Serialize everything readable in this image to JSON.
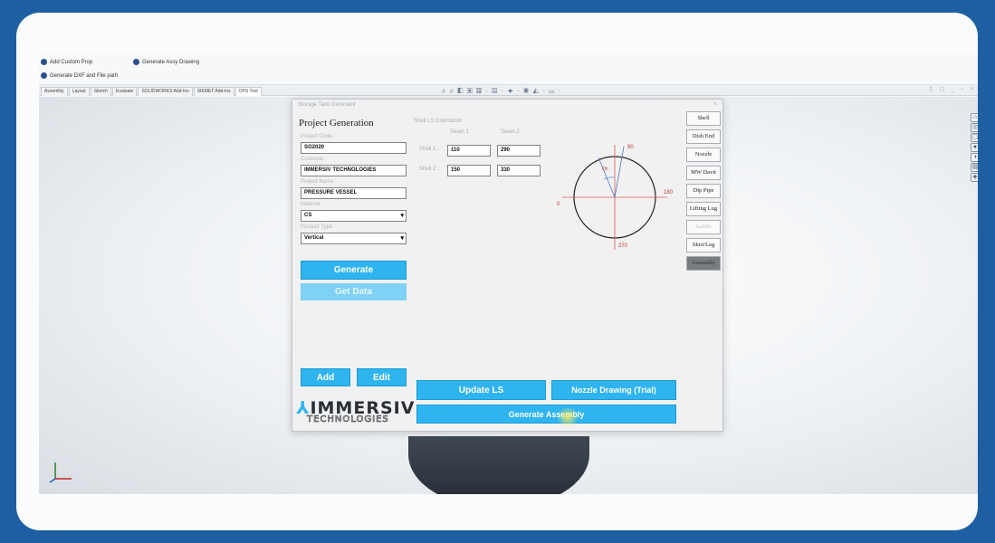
{
  "commands": {
    "add_custom_prop": "Add Custom Prop",
    "generate_assy_drawing": "Generate Assy Drawing",
    "generate_dxf": "Generate DXF and File path"
  },
  "tabs": [
    "Assembly",
    "Layout",
    "Sketch",
    "Evaluate",
    "SOLIDWORKS Add-Ins",
    "SIEMET Add-Ins",
    "OPS Tool"
  ],
  "view_tools": "⌕ ⌕ ◧ ▣ ▦ · ▤ · ✦ · ◉ ◭ · ▭ ·",
  "window_controls": "▯ ▢ _ ▫ ×",
  "dialog": {
    "title": "Storage Tank Generator",
    "close": "×",
    "heading": "Project Generation",
    "project_code_label": "Project Code :",
    "project_code_value": "SO2020",
    "customer_label": "Customer :",
    "customer_value": "IMMERSIV TECHNOLOGIES",
    "project_name_label": "Project Name :",
    "project_name_value": "PRESSURE VESSEL",
    "material_label": "Material :",
    "material_value": "CS",
    "product_type_label": "Product Type :",
    "product_type_value": "Vertical",
    "generate_label": "Generate",
    "get_data_label": "Get Data",
    "add_label": "Add",
    "edit_label": "Edit",
    "orientation_title": "Shell LS Orientation",
    "seam1_header": "Seam 1",
    "seam2_header": "Seam 2",
    "shell1_label": "Shell 1 :",
    "shell2_label": "Shell 2 :",
    "shell1_seam1": "110",
    "shell1_seam2": "290",
    "shell2_seam1": "150",
    "shell2_seam2": "330",
    "angle_90": "90",
    "angle_0": "0",
    "angle_180": "180",
    "angle_270": "270",
    "angle_small": "On",
    "update_ls_label": "Update LS",
    "nozzle_drawing_label": "Nozzle Drawing (Trial)",
    "generate_assembly_label": "Generate Assembly",
    "side_buttons": {
      "shell": "Shell",
      "dish_end": "Dish End",
      "nozzle": "Nozzle",
      "mw_davit": "MW Davit",
      "dip_pipe": "Dip Pipe",
      "lifting_lug": "Lifting Lug",
      "saddle": "Saddle",
      "skirt_leg": "Skirt/Leg",
      "assembly": "Assembly"
    }
  },
  "logo": {
    "brand": "IMMERSIV",
    "sub": "TECHNOLOGIES"
  }
}
